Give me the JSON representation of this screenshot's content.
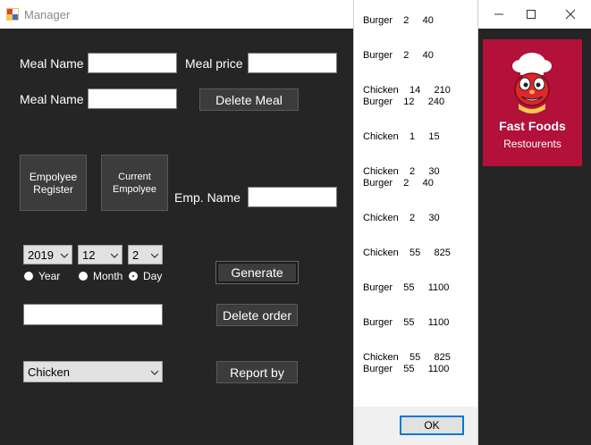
{
  "window": {
    "title": "Manager"
  },
  "form": {
    "meal_name_label": "Meal Name",
    "meal_price_label": "Meal price",
    "meal_name_label_2": "Meal Name",
    "delete_meal_button": "Delete Meal",
    "employee_register_button_l1": "Empolyee",
    "employee_register_button_l2": "Register",
    "current_employee_button_l1": "Current",
    "current_employee_button_l2": "Empolyee",
    "emp_name_label": "Emp. Name",
    "year_value": "2019",
    "month_value": "12",
    "day_value": "2",
    "radio_year": "Year",
    "radio_month": "Month",
    "radio_day": "Day",
    "generate_button": "Generate",
    "delete_order_button": "Delete order",
    "category_value": "Chicken",
    "report_by_button": "Report by"
  },
  "logo": {
    "line1": "Fast Foods",
    "line2": "Restourents"
  },
  "message_box": {
    "lines": [
      "Burger    2     40",
      "Burger    2     40",
      "Chicken    14     210",
      "Burger    12     240",
      "Chicken    1     15",
      "Chicken    2     30",
      "Burger    2     40",
      "Chicken    2     30",
      "Chicken    55     825",
      "Burger    55     1100",
      "Burger    55     1100",
      "Chicken    55     825",
      "Burger    55     1100"
    ],
    "ok_button": "OK"
  },
  "colors": {
    "background": "#252526",
    "logo_red": "#b3103a",
    "ok_border": "#0078d7"
  },
  "icons": [
    "app-icon",
    "minimize-icon",
    "maximize-icon",
    "close-icon",
    "chevron-down-icon",
    "mascot-icon"
  ]
}
